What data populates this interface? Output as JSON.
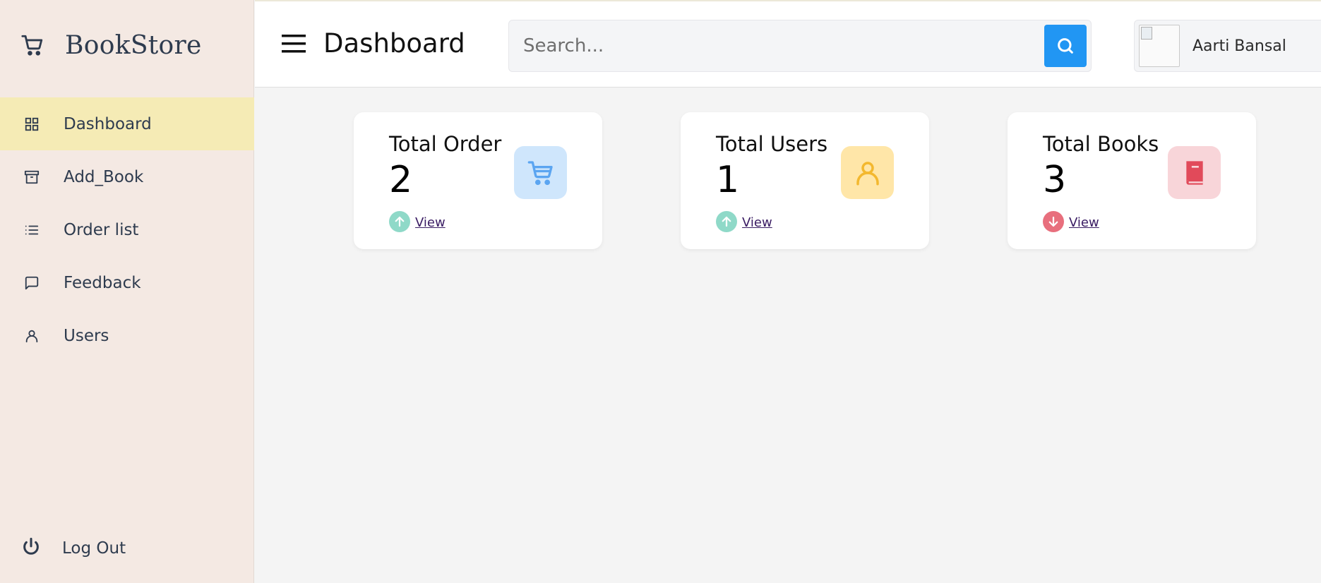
{
  "brand": {
    "name": "BookStore"
  },
  "sidebar": {
    "items": [
      {
        "label": "Dashboard",
        "active": true
      },
      {
        "label": "Add_Book",
        "active": false
      },
      {
        "label": "Order list",
        "active": false
      },
      {
        "label": "Feedback",
        "active": false
      },
      {
        "label": "Users",
        "active": false
      }
    ],
    "logout_label": "Log Out"
  },
  "header": {
    "title": "Dashboard",
    "search_placeholder": "Search...",
    "user_name": "Aarti Bansal"
  },
  "cards": [
    {
      "title": "Total Order",
      "value": "2",
      "link": "View",
      "trend": "up",
      "icon": "cart-icon",
      "tile_color": "#cfe6fc",
      "icon_color": "#5ba5f1"
    },
    {
      "title": "Total Users",
      "value": "1",
      "link": "View",
      "trend": "up",
      "icon": "user-icon",
      "tile_color": "#ffe6a8",
      "icon_color": "#f3b82f"
    },
    {
      "title": "Total Books",
      "value": "3",
      "link": "View",
      "trend": "down",
      "icon": "book-icon",
      "tile_color": "#f8d5d9",
      "icon_color": "#e14a5a"
    }
  ],
  "colors": {
    "sidebar_bg": "#f4e9e3",
    "active_bg": "#f5ebb5",
    "accent": "#2196f3",
    "trend_up": "#8fd9c8",
    "trend_down": "#e86f7d"
  }
}
